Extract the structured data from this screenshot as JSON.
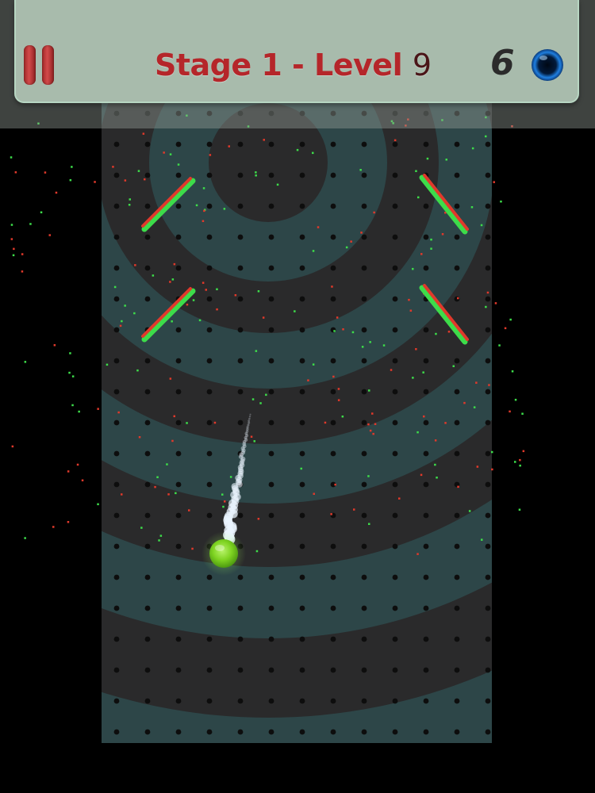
{
  "hud": {
    "pause_icon": "pause-icon",
    "title_text": "Stage 1 - Level",
    "level_number": "9",
    "balls_remaining": "6",
    "ball_icon": "blue-orb-icon"
  },
  "colors": {
    "background": "#000000",
    "board_dark": "#2a2a2b",
    "ring_teal": "#2d4648",
    "peg": "#0d0d0d",
    "bumper_red": "#e0392b",
    "bumper_green": "#3ddc4a",
    "ball_green": "#7ed321",
    "title_red": "#b5262a"
  },
  "board": {
    "rings": 6,
    "bumpers": [
      {
        "name": "bumper-top-left",
        "angle": "down-left"
      },
      {
        "name": "bumper-top-right",
        "angle": "down-right"
      },
      {
        "name": "bumper-mid-left",
        "angle": "down-left"
      },
      {
        "name": "bumper-mid-right",
        "angle": "down-right"
      }
    ],
    "ball": {
      "name": "player-ball",
      "state": "moving"
    }
  }
}
